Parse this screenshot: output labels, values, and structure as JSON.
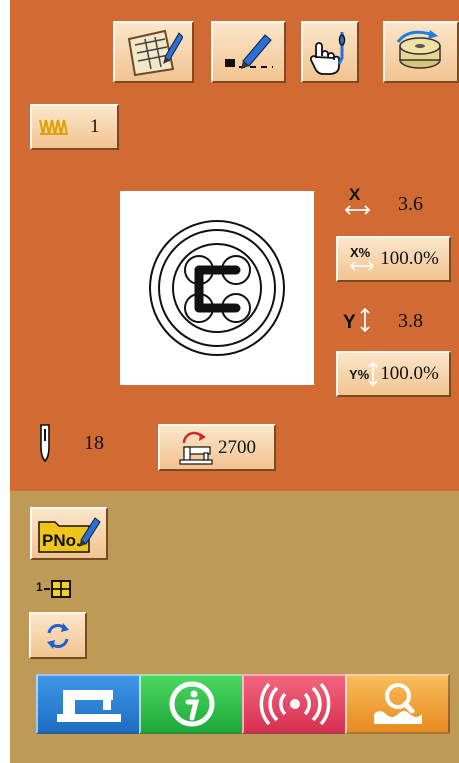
{
  "top_toolbar": {
    "buttons": [
      "pattern-edit-icon",
      "stitch-edit-icon",
      "hand-needle-icon",
      "bobbin-winder-icon"
    ]
  },
  "pattern": {
    "number": "1"
  },
  "scale": {
    "x_size": "3.6",
    "x_percent": "100.0%",
    "y_size": "3.8",
    "y_percent": "100.0%",
    "x_label": "X",
    "x_pct_label": "X%",
    "y_label": "Y",
    "y_pct_label": "Y%"
  },
  "stitch": {
    "count": "18",
    "speed": "2700"
  },
  "pattern_no": {
    "label": "PNo.",
    "index": "1"
  },
  "bottom_nav": {
    "buttons": [
      "sewing-machine-icon",
      "info-icon",
      "communication-icon",
      "search-icon"
    ]
  },
  "colors": {
    "top_panel": "#d26a33",
    "bottom_panel": "#bf9a56",
    "button_face": "#f5d3a8",
    "nav_blue": "#2c7fd2",
    "nav_green": "#2fc14a",
    "nav_red": "#e04b66",
    "nav_orange": "#f2a23a"
  }
}
